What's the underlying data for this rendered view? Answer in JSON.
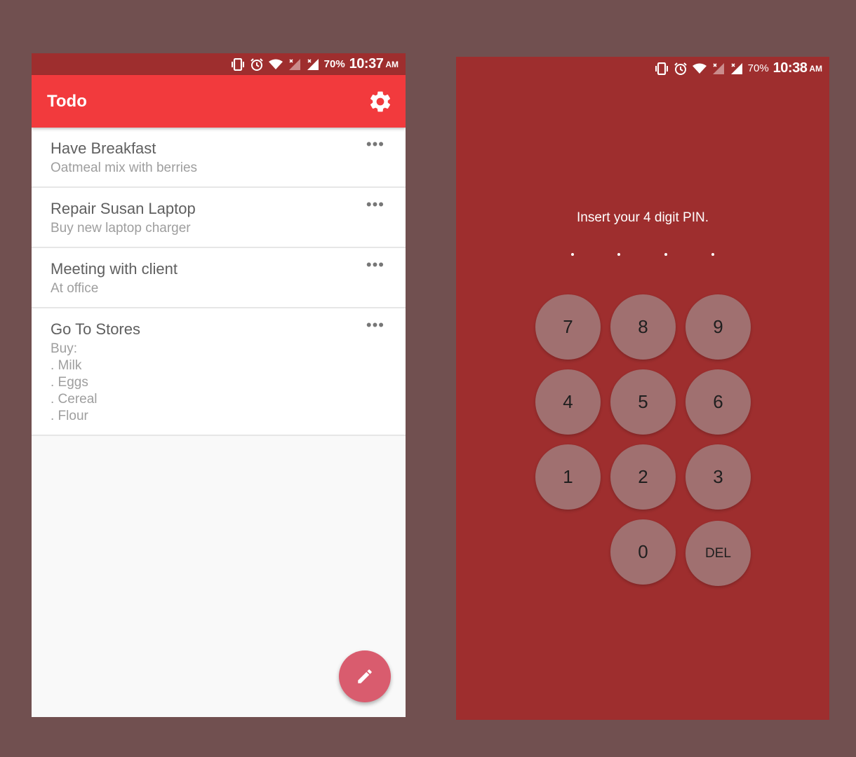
{
  "todo_screen": {
    "status_bar": {
      "battery": "70%",
      "time": "10:37",
      "ampm": "AM",
      "icons": [
        "vibrate-icon",
        "alarm-icon",
        "wifi-icon",
        "signal-no-data-icon",
        "signal-icon"
      ]
    },
    "app_bar": {
      "title": "Todo",
      "settings_icon": "gear-icon",
      "color": "#f23a3d"
    },
    "items": [
      {
        "title": "Have Breakfast",
        "description": "Oatmeal mix with berries",
        "menu_label": "•••"
      },
      {
        "title": "Repair Susan Laptop",
        "description": "Buy new laptop charger",
        "menu_label": "•••"
      },
      {
        "title": "Meeting with client",
        "description": "At office",
        "menu_label": "•••"
      },
      {
        "title": "Go To Stores",
        "description": "Buy:\n. Milk\n. Eggs\n. Cereal\n. Flour",
        "menu_label": "•••"
      }
    ],
    "fab": {
      "icon": "pencil-icon",
      "color": "#d95c6e"
    }
  },
  "pin_screen": {
    "status_bar": {
      "battery": "70%",
      "time": "10:38",
      "ampm": "AM",
      "icons": [
        "vibrate-icon",
        "alarm-icon",
        "wifi-icon",
        "signal-no-data-icon",
        "signal-icon"
      ]
    },
    "prompt": "Insert your 4 digit PIN.",
    "dots": [
      ".",
      ".",
      ".",
      "."
    ],
    "keys": {
      "k7": "7",
      "k8": "8",
      "k9": "9",
      "k4": "4",
      "k5": "5",
      "k6": "6",
      "k1": "1",
      "k2": "2",
      "k3": "3",
      "k0": "0",
      "del": "DEL"
    },
    "background_color": "#9e2e2e"
  }
}
